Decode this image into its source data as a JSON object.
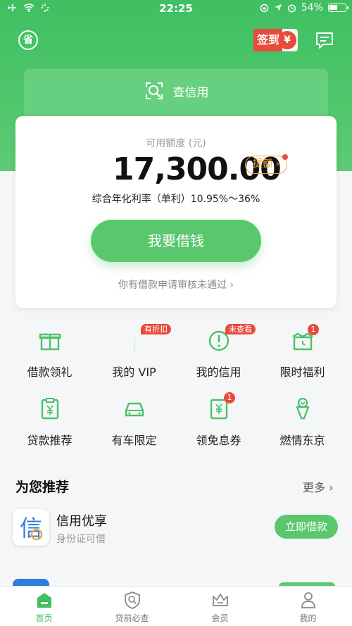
{
  "status_bar": {
    "time": "22:25",
    "battery": "54%"
  },
  "header": {
    "save_icon_char": "省",
    "signin_label": "签到",
    "signin_coin": "¥",
    "credit_check_label": "查信用"
  },
  "quota_card": {
    "label": "可用额度 (元)",
    "amount": "17,300.00",
    "raise_label": "提额",
    "rate_text": "综合年化利率（单利）10.95%～36%",
    "borrow_button": "我要借钱",
    "review_note": "你有借款申请审核未通过"
  },
  "grid": [
    {
      "label": "借款领礼",
      "icon": "gift-icon"
    },
    {
      "label": "我的 VIP",
      "icon": "vip-icon",
      "tag": "有折扣"
    },
    {
      "label": "我的信用",
      "icon": "alert-icon",
      "tag": "未查看"
    },
    {
      "label": "限时福利",
      "icon": "gift-clock-icon",
      "badge": "1"
    },
    {
      "label": "贷款推荐",
      "icon": "clipboard-yen-icon"
    },
    {
      "label": "有车限定",
      "icon": "car-icon"
    },
    {
      "label": "领免息券",
      "icon": "coupon-icon",
      "badge": "1"
    },
    {
      "label": "燃情东京",
      "icon": "torch-icon"
    }
  ],
  "recommend": {
    "title": "为您推荐",
    "more": "更多",
    "items": [
      {
        "name": "信用优享",
        "sub": "身份证可借",
        "button": "立即借款",
        "logo_char": "信"
      }
    ]
  },
  "tabbar": [
    {
      "label": "首页",
      "icon": "home-icon",
      "active": true
    },
    {
      "label": "贷前必查",
      "icon": "shield-icon",
      "active": false
    },
    {
      "label": "会员",
      "icon": "crown-icon",
      "active": false
    },
    {
      "label": "我的",
      "icon": "profile-icon",
      "active": false
    }
  ],
  "colors": {
    "brand_green": "#3fbf62",
    "accent_red": "#e84b3c",
    "orange": "#f0a546"
  }
}
